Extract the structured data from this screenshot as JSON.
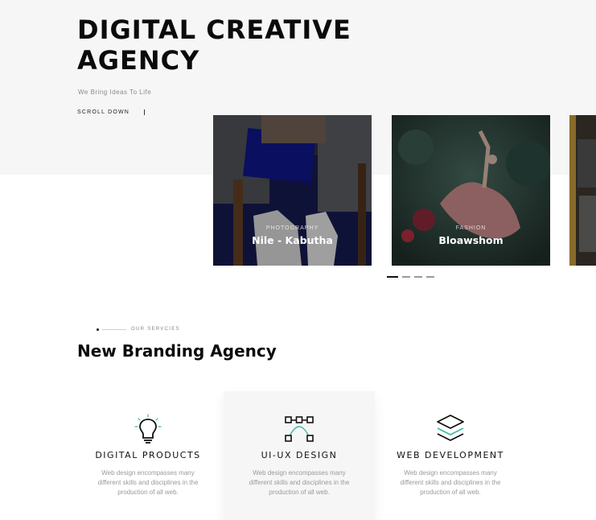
{
  "hero": {
    "title_line1": "DIGITAL CREATIVE",
    "title_line2": "AGENCY",
    "subtitle": "We Bring Ideas To Life",
    "scroll_label": "SCROLL DOWN"
  },
  "portfolio": {
    "cards": [
      {
        "category": "PHOTOGRAPHY",
        "name": "Nile - Kabutha"
      },
      {
        "category": "FASHION",
        "name": "Bloawshom"
      },
      {
        "category": "",
        "name": ""
      }
    ],
    "dots": 4,
    "active_dot": 0
  },
  "services_section": {
    "label": "OUR SERVCIES",
    "title": "New Branding Agency",
    "items": [
      {
        "icon": "lightbulb-icon",
        "title": "DIGITAL PRODUCTS",
        "description": "Web design encompasses many different skills and disciplines in the production of all web."
      },
      {
        "icon": "vector-bezier-icon",
        "title": "UI-UX DESIGN",
        "description": "Web design encompasses many different skills and disciplines in the production of all web."
      },
      {
        "icon": "layers-icon",
        "title": "WEB DEVELOPMENT",
        "description": "Web design encompasses many different skills and disciplines in the production of all web."
      }
    ]
  },
  "colors": {
    "accent": "#3fb9a4",
    "text": "#0b0b0b",
    "muted": "#9a9a9a"
  }
}
